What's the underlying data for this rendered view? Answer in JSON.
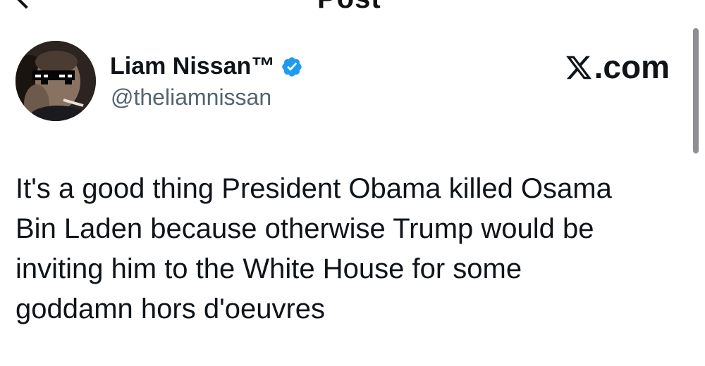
{
  "header": {
    "title": "Post",
    "back_icon": "back-arrow-icon"
  },
  "author": {
    "display_name": "Liam Nissan™",
    "handle": "@theliamnissan",
    "verified": true,
    "verified_color": "#1d9bf0",
    "avatar_icon": "profile-avatar"
  },
  "brand": {
    "label": ".com",
    "logo_icon": "x-logo-icon"
  },
  "tweet": {
    "text": "It's a good thing President Obama killed Osama\nBin Laden because otherwise Trump would be\ninviting him to the White House for some\ngoddamn hors d'oeuvres"
  }
}
